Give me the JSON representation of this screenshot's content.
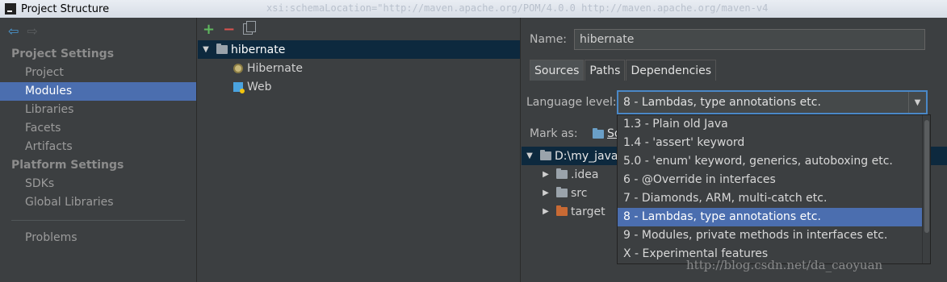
{
  "window": {
    "title": "Project Structure",
    "ghost_text": "xsi:schemaLocation=\"http://maven.apache.org/POM/4.0.0 http://maven.apache.org/maven-v4"
  },
  "left": {
    "sections": [
      {
        "label": "Project Settings",
        "items": [
          "Project",
          "Modules",
          "Libraries",
          "Facets",
          "Artifacts"
        ]
      },
      {
        "label": "Platform Settings",
        "items": [
          "SDKs",
          "Global Libraries"
        ]
      }
    ],
    "selected": "Modules",
    "problems": "Problems"
  },
  "middle": {
    "module": "hibernate",
    "facets": [
      "Hibernate",
      "Web"
    ]
  },
  "right": {
    "name_label": "Name:",
    "name_value": "hibernate",
    "tabs": [
      "Sources",
      "Paths",
      "Dependencies"
    ],
    "active_tab": "Sources",
    "language_label": "Language level:",
    "language_value": "8 - Lambdas, type annotations etc.",
    "mark_label": "Mark as:",
    "mark_sources": "So",
    "tree": {
      "root": "D:\\my_java_",
      "children": [
        ".idea",
        "src",
        "target"
      ]
    }
  },
  "dropdown": {
    "options": [
      "1.3 - Plain old Java",
      "1.4 - 'assert' keyword",
      "5.0 - 'enum' keyword, generics, autoboxing etc.",
      "6 - @Override in interfaces",
      "7 - Diamonds, ARM, multi-catch etc.",
      "8 - Lambdas, type annotations etc.",
      "9 - Modules, private methods in interfaces etc.",
      "X - Experimental features"
    ],
    "selected_index": 5
  },
  "watermark": "http://blog.csdn.net/da_caoyuan",
  "colors": {
    "selection": "#4b6eaf",
    "panel": "#3c3f41",
    "tree_selection": "#0d293e"
  }
}
